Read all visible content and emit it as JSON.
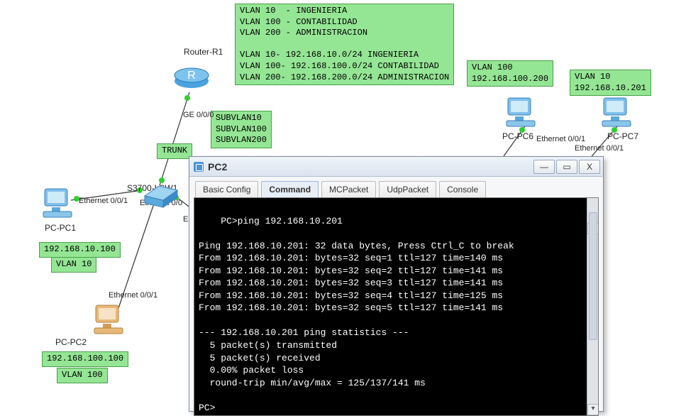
{
  "notes": {
    "vlan_def": "VLAN 10  - INGENIERIA\nVLAN 100 - CONTABILIDAD\nVLAN 200 - ADMINISTRACION\n\nVLAN 10- 192.168.10.0/24 INGENIERIA\nVLAN 100- 192.168.100.0/24 CONTABILIDAD\nVLAN 200- 192.168.200.0/24 ADMINISTRACION",
    "subvlan": "SUBVLAN10\nSUBVLAN100\nSUBVLAN200",
    "trunk": "TRUNK",
    "pc6_note": "VLAN 100\n192.168.100.200",
    "pc7_note": "VLAN 10\n192.168.10.201",
    "pc1_ip": "192.168.10.100",
    "pc1_vlan": "VLAN 10",
    "pc2_ip": "192.168.100.100",
    "pc2_vlan": "VLAN 100"
  },
  "devices": {
    "router": "Router-R1",
    "switch": "S3700-LSW1",
    "pc1": "PC-PC1",
    "pc2": "PC-PC2",
    "pc6": "PC-PC6",
    "pc7": "PC-PC7"
  },
  "ports": {
    "ge000": "GE 0/0/0",
    "eth001_a": "Ethernet 0/0/1",
    "eth00x": "Ethernet 0/0",
    "eth_cut": "E",
    "eth001_pc2": "Ethernet 0/0/1",
    "eth001_pc6": "Ethernet 0/0/1",
    "eth001_pc7": "Ethernet 0/0/1"
  },
  "window": {
    "title": "PC2",
    "tabs": [
      "Basic Config",
      "Command",
      "MCPacket",
      "UdpPacket",
      "Console"
    ],
    "active_tab": 1,
    "terminal": "PC>ping 192.168.10.201\n\nPing 192.168.10.201: 32 data bytes, Press Ctrl_C to break\nFrom 192.168.10.201: bytes=32 seq=1 ttl=127 time=140 ms\nFrom 192.168.10.201: bytes=32 seq=2 ttl=127 time=141 ms\nFrom 192.168.10.201: bytes=32 seq=3 ttl=127 time=141 ms\nFrom 192.168.10.201: bytes=32 seq=4 ttl=127 time=125 ms\nFrom 192.168.10.201: bytes=32 seq=5 ttl=127 time=141 ms\n\n--- 192.168.10.201 ping statistics ---\n  5 packet(s) transmitted\n  5 packet(s) received\n  0.00% packet loss\n  round-trip min/avg/max = 125/137/141 ms\n\nPC>"
  }
}
